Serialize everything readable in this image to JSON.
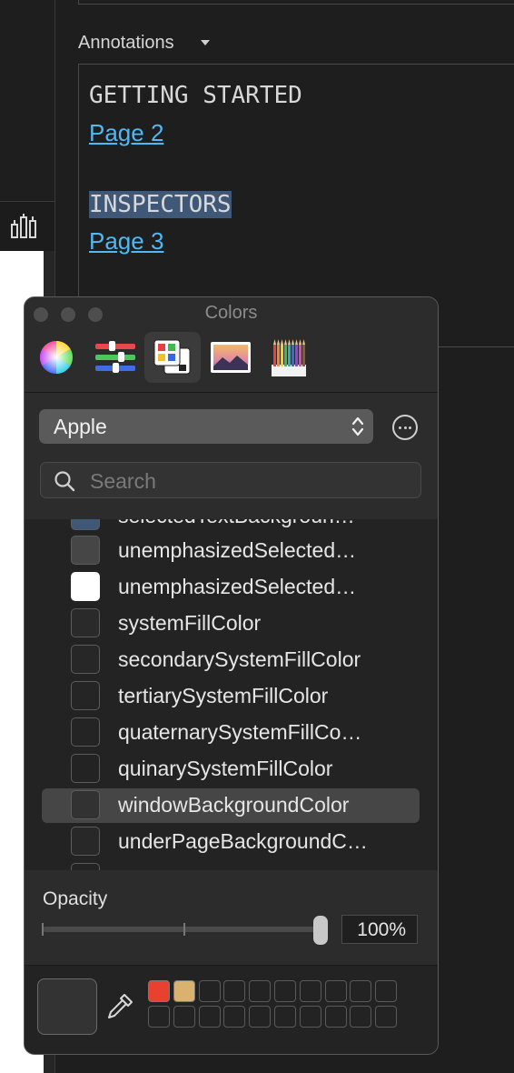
{
  "editor": {
    "annotations_label": "Annotations",
    "lines": [
      {
        "text": "GETTING STARTED",
        "kind": "heading"
      },
      {
        "text": "Page 2",
        "kind": "link"
      },
      {
        "text": "INSPECTORS",
        "kind": "heading-selected"
      },
      {
        "text": "Page 3",
        "kind": "link"
      }
    ],
    "link_color": "#4fb9f3",
    "selection_color": "#3f5877"
  },
  "panel": {
    "title": "Colors",
    "modes": [
      "color-wheel-icon",
      "color-sliders-icon",
      "color-palettes-icon",
      "image-palettes-icon",
      "pencils-icon"
    ],
    "active_mode": "color-palettes-icon",
    "palette_popup": {
      "value": "Apple"
    },
    "search": {
      "placeholder": "Search",
      "value": ""
    },
    "colors": [
      {
        "name": "selectedTextBackgroun…",
        "swatch": "#3f5877"
      },
      {
        "name": "unemphasizedSelected…",
        "swatch": "#464646"
      },
      {
        "name": "unemphasizedSelected…",
        "swatch": "#ffffff"
      },
      {
        "name": "systemFillColor",
        "swatch": "#2a2a2a"
      },
      {
        "name": "secondarySystemFillColor",
        "swatch": "#272727"
      },
      {
        "name": "tertiarySystemFillColor",
        "swatch": "#252525"
      },
      {
        "name": "quaternarySystemFillCo…",
        "swatch": "#242424"
      },
      {
        "name": "quinarySystemFillColor",
        "swatch": "#232323"
      },
      {
        "name": "windowBackgroundColor",
        "swatch": "#323232",
        "selected": true
      },
      {
        "name": "underPageBackgroundC…",
        "swatch": "#282828"
      },
      {
        "name": "",
        "swatch": "#232323"
      }
    ],
    "opacity": {
      "label": "Opacity",
      "value_text": "100%",
      "value": 1.0
    },
    "current_color": "#333333",
    "favorites": [
      "#e8412f",
      "#d8b26e"
    ]
  }
}
